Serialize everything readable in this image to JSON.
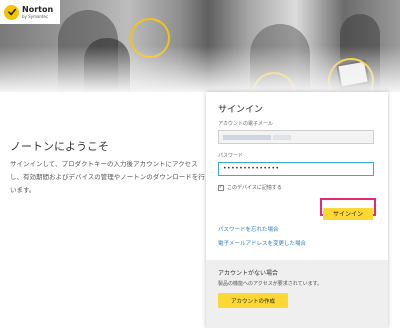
{
  "brand": {
    "name": "Norton",
    "byline": "by Symantec",
    "accent_color": "#f4c300"
  },
  "welcome": {
    "title": "ノートンにようこそ",
    "description": "サインインして、プロダクトキーの入力後アカウントにアクセスし、有効期間およびデバイスの管理やノートンのダウンロードを行います。"
  },
  "signin": {
    "title": "サインイン",
    "email_label": "アカウントの電子メール",
    "email_value": "",
    "password_label": "パスワード",
    "password_value": "••••••••••••••",
    "remember_checked": "✓",
    "remember_label": "このデバイスに記憶する",
    "signin_button": "サインイン",
    "forgot_password_link": "パスワードを忘れた場合",
    "changed_email_link": "電子メールアドレスを変更した場合"
  },
  "no_account": {
    "heading": "アカウントがない場合",
    "description": "製品の機能へのアクセスが要求されています。",
    "create_button": "アカウントの作成"
  },
  "colors": {
    "primary_button": "#fdd835",
    "highlight_border": "#e0287d",
    "link": "#2a7bbd",
    "focus_border": "#3ea9ce"
  }
}
